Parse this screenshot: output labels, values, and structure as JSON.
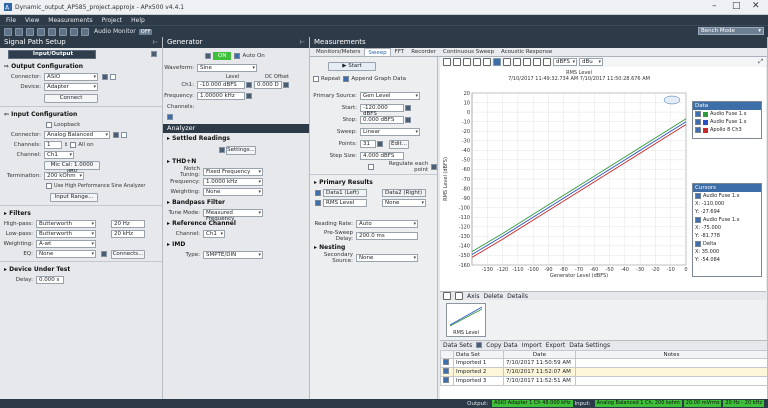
{
  "window": {
    "title": "Dynamic_output_AP585_project.approjx - APx500 v4.4.1"
  },
  "menu": [
    "File",
    "View",
    "Measurements",
    "Project",
    "Help"
  ],
  "toolbar": {
    "audio_monitor_label": "Audio Monitor",
    "audio_monitor_state": "OFF",
    "bench_mode": "Bench Mode"
  },
  "signal_path": {
    "header": "Signal Path Setup",
    "selector": "Input/Output",
    "output": {
      "title": "Output Configuration",
      "connector_label": "Connector:",
      "connector_value": "ASIO",
      "device_label": "Device:",
      "device_value": "Adapter",
      "connect_button": "Connect"
    },
    "input": {
      "title": "Input Configuration",
      "loopback_label": "Loopback",
      "connector_label": "Connector:",
      "connector_value": "Analog Balanced",
      "channels_label": "Channels:",
      "channels_value": "1",
      "all_on_label": "All on",
      "channel_label": "Channel:",
      "channel_value": "Ch1",
      "mic_button": "Mic Cal: 1.0000 dBV",
      "termination_label": "Termination:",
      "termination_value": "200 kOhm",
      "high_bw_label": "Use High Performance Sine Analyzer",
      "input_range_button": "Input Range..."
    },
    "filters": {
      "title": "Filters",
      "highpass_label": "High-pass:",
      "highpass_type": "Butterworth",
      "highpass_freq": "20 Hz",
      "lowpass_label": "Low-pass:",
      "lowpass_type": "Butterworth",
      "lowpass_freq": "20 kHz",
      "weighting_label": "Weighting:",
      "weighting_value": "A-wt",
      "eq_label": "EQ:",
      "eq_value": "None",
      "connects_button": "Connects..."
    },
    "dut": {
      "title": "Device Under Test",
      "delay_label": "Delay:",
      "delay_value": "0.000 s"
    }
  },
  "generator": {
    "header": "Generator",
    "on_label": "ON",
    "auto_on_label": "Auto On",
    "waveform_label": "Waveform:",
    "waveform_value": "Sine",
    "level_header": "Level",
    "dc_offset_header": "DC Offset",
    "ch1_label": "Ch1:",
    "ch1_level": "-10.000 dBFS",
    "ch1_offset": "0.000 D",
    "frequency_label": "Frequency:",
    "frequency_value": "1.00000 kHz",
    "channels_label": "Channels:"
  },
  "analyzer": {
    "header": "Analyzer",
    "settled_title": "Settled Readings",
    "settings_button": "Settings...",
    "thdn_title": "THD+N",
    "notch_label": "Notch Tuning:",
    "notch_value": "Fixed Frequency",
    "freq_label": "Frequency:",
    "freq_value": "1.0000 kHz",
    "weighting_label": "Weighting:",
    "weighting_value": "None",
    "bandpass_title": "Bandpass Filter",
    "tune_label": "Tune Mode:",
    "tune_value": "Measured Frequency",
    "ref_title": "Reference Channel",
    "ref_channel_label": "Channel:",
    "ref_channel_value": "Ch1",
    "imd_title": "IMD",
    "imd_type_label": "Type:",
    "imd_type_value": "SMPTE/DIN"
  },
  "measurements": {
    "header": "Measurements",
    "tabs": [
      "Monitors/Meters",
      "Sweep",
      "FFT",
      "Recorder",
      "Continuous Sweep",
      "Acoustic Response"
    ],
    "active_tab": "Sweep",
    "start_button": "Start",
    "repeat_label": "Repeat",
    "append_label": "Append Graph Data",
    "primary_source_label": "Primary Source:",
    "primary_source_value": "Gen Level",
    "start_label": "Start:",
    "start_value": "-120.000 dBFS",
    "stop_label": "Stop:",
    "stop_value": "0.000 dBFS",
    "sweep_label": "Sweep:",
    "sweep_value": "Linear",
    "points_label": "Points:",
    "points_value": "31",
    "edit_button": "Edit...",
    "step_size_label": "Step Size:",
    "step_size_value": "4.000 dBFS",
    "regulate_label": "Regulate each point",
    "primary_results_title": "Primary Results",
    "result_col1": "Data1 (Left)",
    "result_col2": "Data2 (Right)",
    "result_row_label": "RMS Level",
    "result_row_value": "None",
    "reading_rate_label": "Reading Rate:",
    "reading_rate_value": "Auto",
    "pre_sweep_label": "Pre-Sweep Delay:",
    "pre_sweep_value": "200.0 ms",
    "nesting_title": "Nesting",
    "secondary_label": "Secondary Source:",
    "secondary_value": "None",
    "graph_toolbar_unit1": "dBFS",
    "graph_toolbar_unit2": "dBu",
    "thumb_label": "RMS Level",
    "bottom_tools": [
      "Axis",
      "Delete",
      "Details"
    ]
  },
  "chart_data": {
    "type": "line",
    "title": "RMS Level",
    "subtitle": "7/10/2017 11:49:32.734 AM  7/10/2017 11:50:28.676 AM",
    "ylabel": "RMS Level (dBFS)",
    "xlabel": "Generator Level (dBFS)",
    "xlim": [
      -140,
      0
    ],
    "ylim": [
      -160,
      20
    ],
    "x_ticks": [
      -130,
      -120,
      -110,
      -100,
      -90,
      -80,
      -70,
      -60,
      -50,
      -40,
      -30,
      -20,
      -10,
      0
    ],
    "y_ticks": [
      20,
      10,
      0,
      -10,
      -20,
      -30,
      -40,
      -50,
      -60,
      -70,
      -80,
      -90,
      -100,
      -110,
      -120,
      -130,
      -140,
      -150,
      -160
    ],
    "grid": true,
    "series": [
      {
        "name": "Audio Fuse 1.x",
        "color": "#2d9b3a",
        "x": [
          -140,
          -120,
          -100,
          -80,
          -60,
          -40,
          -20,
          0
        ],
        "y": [
          -146,
          -127,
          -107,
          -87,
          -67,
          -47,
          -27,
          -7
        ]
      },
      {
        "name": "Audio Fuse 1.x",
        "color": "#2a52c4",
        "x": [
          -140,
          -120,
          -100,
          -80,
          -60,
          -40,
          -20,
          0
        ],
        "y": [
          -149,
          -130,
          -110,
          -90,
          -70,
          -50,
          -30,
          -10
        ]
      },
      {
        "name": "Apollo 8 Ch3",
        "color": "#c82828",
        "x": [
          -140,
          -120,
          -100,
          -80,
          -60,
          -40,
          -20,
          0
        ],
        "y": [
          -152,
          -133,
          -113,
          -93,
          -73,
          -53,
          -33,
          -13
        ]
      }
    ],
    "legend": {
      "title": "Data"
    },
    "cursors": {
      "title": "Cursors",
      "c1_name": "Audio Fuse 1.x",
      "c1_x": "X: -110.000",
      "c1_y": "Y: -27.694",
      "c2_name": "Audio Fuse 1.x",
      "c2_x": "X: -75.000",
      "c2_y": "Y: -81.778",
      "delta_name": "Delta",
      "delta_x": "X: 35.000",
      "delta_y": "Y: -54.084"
    }
  },
  "data_sets": {
    "title": "Data Sets",
    "tools": [
      "Copy Data",
      "Import",
      "Export",
      "Data Settings"
    ],
    "headers": [
      "Data Set",
      "Date",
      "Notes"
    ],
    "rows": [
      {
        "name": "Imported 1",
        "date": "7/10/2017 11:50:59 AM"
      },
      {
        "name": "Imported 2",
        "date": "7/10/2017 11:52:07 AM"
      },
      {
        "name": "Imported 3",
        "date": "7/10/2017 11:52:51 AM"
      }
    ]
  },
  "status": {
    "output_label": "Output:",
    "output_value": "ASIO Adapter 1 Ch  48.000 kHz",
    "input_label": "Input:",
    "input_value": "Analog Balanced 1 Ch, 200 kohm",
    "range_value": "20.00 mVrms",
    "bw_value": "20 Hz - 20 kHz"
  }
}
